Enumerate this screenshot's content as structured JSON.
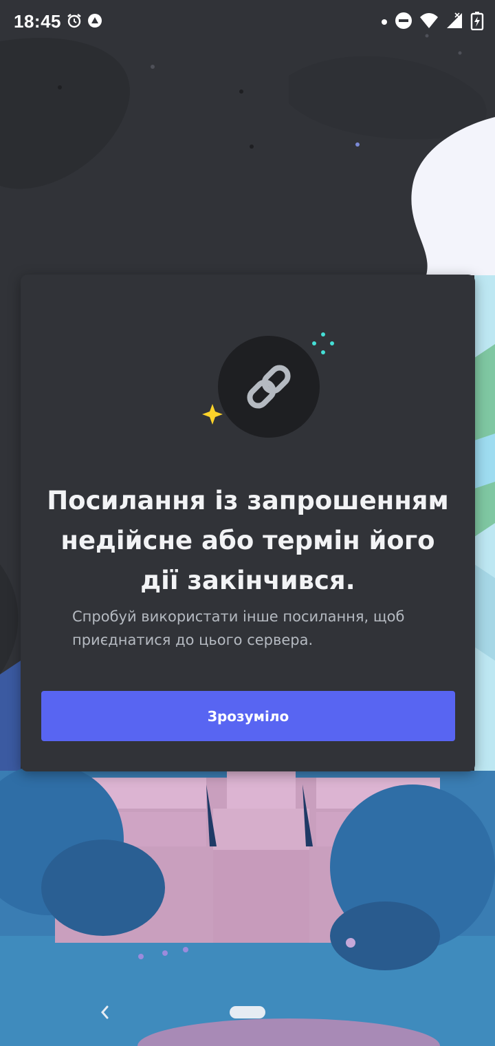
{
  "status_bar": {
    "time": "18:45"
  },
  "colors": {
    "background": "#313338",
    "card": "#313338",
    "primary": "#5865f2",
    "title": "#f2f3f5",
    "description": "#b5bac1",
    "sparkle_teal": "#45dfd6",
    "sparkle_yellow": "#fcd32a"
  },
  "dialog": {
    "title_line1": "Посилання із запрошенням",
    "title_line2": "недійсне або термін його",
    "title_line3": "дії закінчився.",
    "description_line1": "Спробуй використати інше посилання, щоб",
    "description_line2": "приєднатися до цього сервера.",
    "button_label": "Зрозуміло",
    "icon": "link-icon"
  },
  "navigation": {
    "back_icon": "back-chevron-icon",
    "home_icon": "home-pill-icon"
  }
}
